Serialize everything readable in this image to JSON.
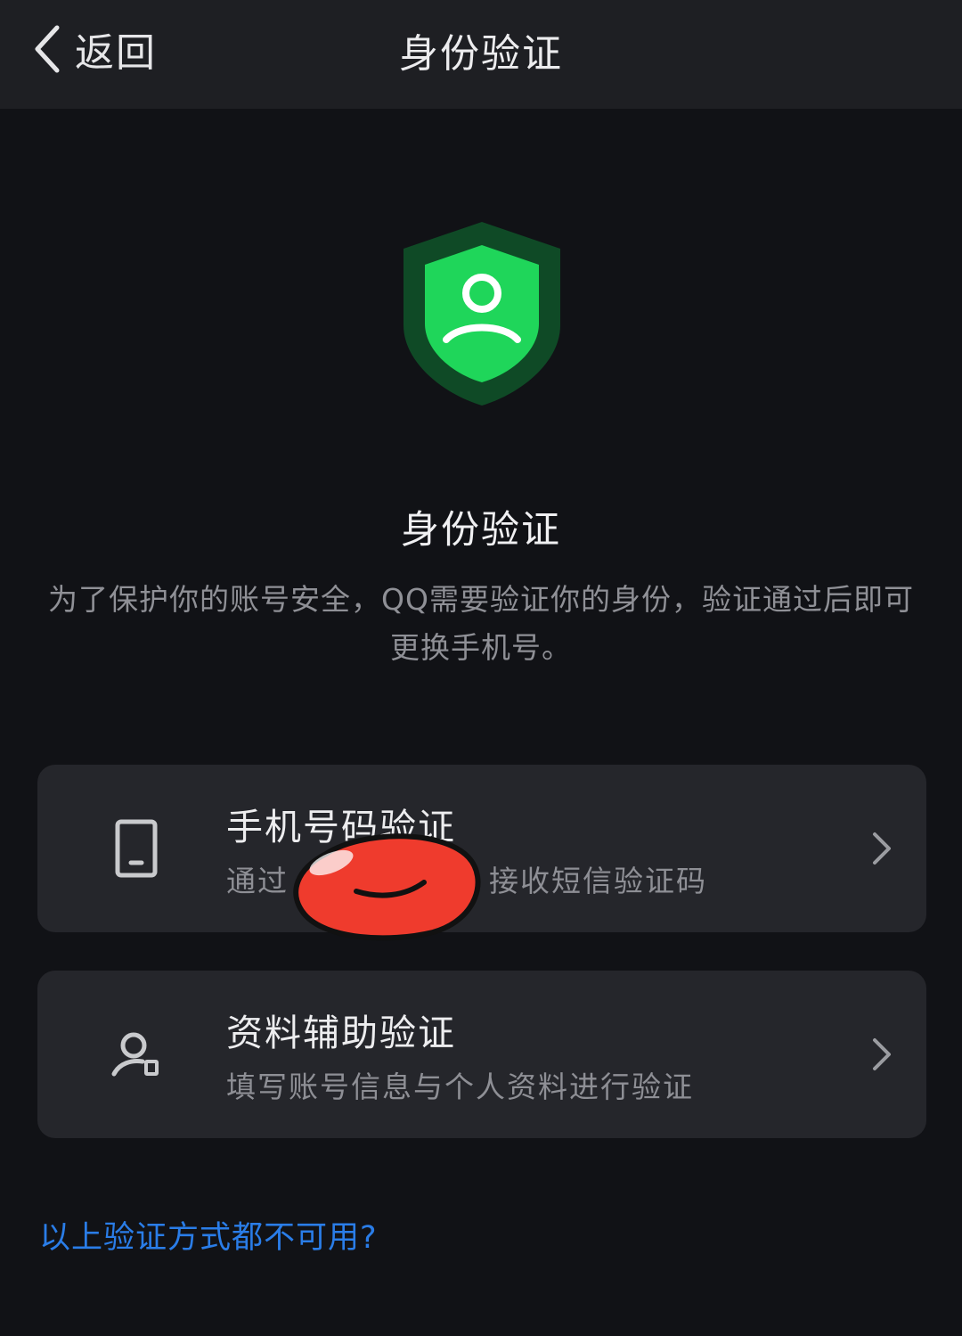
{
  "nav": {
    "back_label": "返回",
    "title": "身份验证"
  },
  "hero": {
    "heading": "身份验证",
    "description": "为了保护你的账号安全，QQ需要验证你的身份，验证通过后即可更换手机号。",
    "shield_colors": {
      "outer": "#0f4a26",
      "inner": "#1fd65a"
    }
  },
  "options": [
    {
      "title": "手机号码验证",
      "subtitle_before": "通过",
      "subtitle_after": "接收短信验证码",
      "icon": "phone-icon"
    },
    {
      "title": "资料辅助验证",
      "subtitle": "填写账号信息与个人资料进行验证",
      "icon": "user-doc-icon"
    }
  ],
  "footer_link": "以上验证方式都不可用?",
  "colors": {
    "background": "#111216",
    "card": "#25262b",
    "link": "#2a7de8",
    "redaction": "#ef3b2d"
  }
}
